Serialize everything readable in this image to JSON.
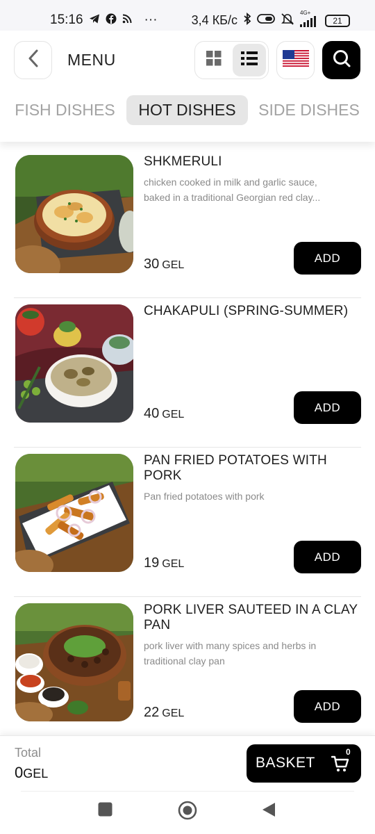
{
  "status_bar": {
    "time": "15:16",
    "more": "···",
    "speed": "3,4 КБ/с",
    "battery": "21",
    "network": "4G+"
  },
  "header": {
    "title": "MENU",
    "icons": [
      "back-arrow-icon",
      "grid-view-icon",
      "list-view-icon",
      "us-flag-icon",
      "search-icon"
    ]
  },
  "tabs": [
    {
      "label": "FISH DISHES",
      "active": false
    },
    {
      "label": "HOT DISHES",
      "active": true
    },
    {
      "label": "SIDE DISHES",
      "active": false
    }
  ],
  "items": [
    {
      "name": "SHKMERULI",
      "description": "chicken cooked in milk and garlic sauce, baked in a traditional Georgian red clay...",
      "price": "30",
      "currency": "GEL",
      "button": "ADD"
    },
    {
      "name": "CHAKAPULI (SPRING-SUMMER)",
      "description": "",
      "price": "40",
      "currency": "GEL",
      "button": "ADD"
    },
    {
      "name": "PAN FRIED POTATOES WITH PORK",
      "description": "Pan fried potatoes with pork",
      "price": "19",
      "currency": "GEL",
      "button": "ADD"
    },
    {
      "name": "PORK LIVER SAUTEED IN A CLAY PAN",
      "description": "pork liver with many spices and herbs in traditional clay pan",
      "price": "22",
      "currency": "GEL",
      "button": "ADD"
    }
  ],
  "footer": {
    "total_label": "Total",
    "total_value": "0",
    "total_currency": "GEL",
    "basket_label": "BASKET",
    "basket_count": "0"
  },
  "colors": {
    "accent": "#000000",
    "muted_text": "#8a8a8a",
    "active_tab_bg": "#e6e6e6"
  }
}
